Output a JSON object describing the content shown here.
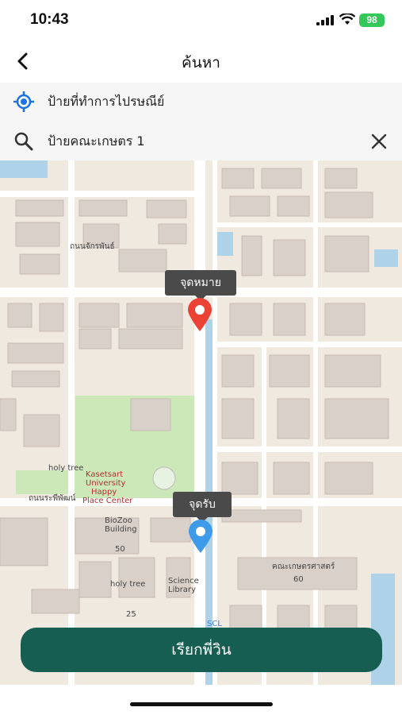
{
  "status_bar": {
    "time": "10:43",
    "battery": "98"
  },
  "nav": {
    "title": "ค้นหา"
  },
  "search": {
    "pickup": "ป้ายที่ทำการไปรษณีย์",
    "destination": "ป้ายคณะเกษตร 1"
  },
  "map": {
    "labels": {
      "holy_tree_1": "holy tree",
      "holy_tree_2": "holy tree",
      "kasetsart_1": "Kasetsart",
      "kasetsart_2": "University",
      "kasetsart_3": "Happy",
      "kasetsart_4": "Place Center",
      "biozoo_1": "BioZoo",
      "biozoo_2": "Building",
      "science_library_1": "Science",
      "science_library_2": "Library",
      "road_1": "ถนนจักรพันธ์",
      "road_2": "ถนนระพีพัฒน์",
      "building_50": "50",
      "building_25": "25",
      "building_60": "60",
      "faculty_sci": "คณะเกษตรศาสตร์",
      "scl": "SCL"
    },
    "destination_tooltip": "จุดหมาย",
    "pickup_tooltip": "จุดรับ",
    "colors": {
      "destination_pin": "#ea4335",
      "pickup_pin": "#3d9be9"
    }
  },
  "action": {
    "call_label": "เรียกพี่วิน",
    "color": "#155e51"
  }
}
